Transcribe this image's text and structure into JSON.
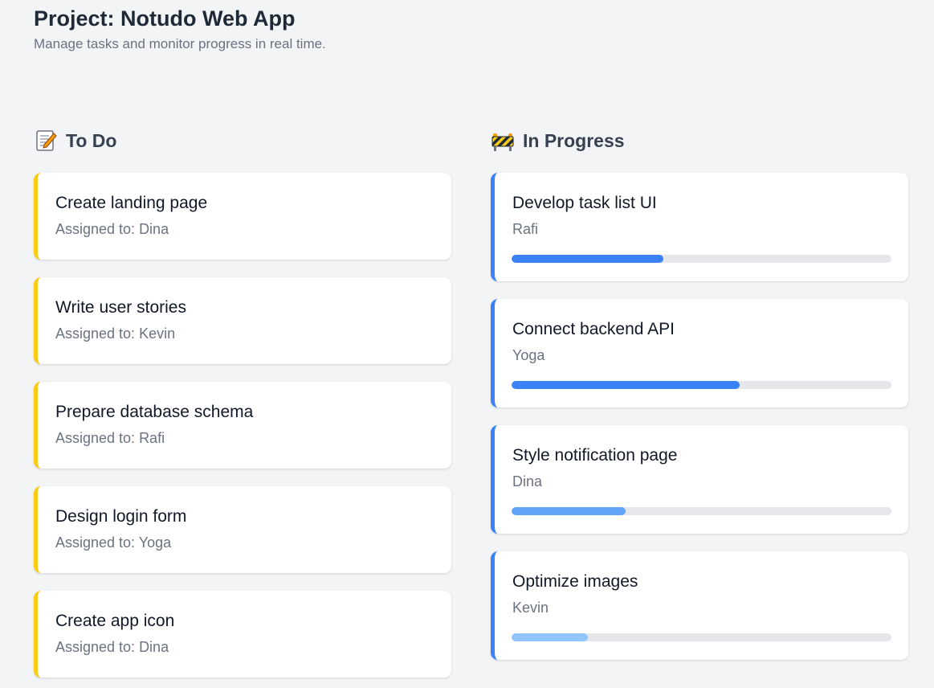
{
  "header": {
    "title": "Project: Notudo Web App",
    "subtitle": "Manage tasks and monitor progress in real time."
  },
  "columns": {
    "todo": {
      "title": "To Do",
      "icon": "memo-icon",
      "accent": "#facc15",
      "cards": [
        {
          "title": "Create landing page",
          "assignee": "Assigned to: Dina"
        },
        {
          "title": "Write user stories",
          "assignee": "Assigned to: Kevin"
        },
        {
          "title": "Prepare database schema",
          "assignee": "Assigned to: Rafi"
        },
        {
          "title": "Design login form",
          "assignee": "Assigned to: Yoga"
        },
        {
          "title": "Create app icon",
          "assignee": "Assigned to: Dina"
        }
      ]
    },
    "in_progress": {
      "title": "In Progress",
      "icon": "construction-barrier-icon",
      "accent": "#3b82f6",
      "cards": [
        {
          "title": "Develop task list UI",
          "assignee": "Rafi",
          "progress": 0.4,
          "bar_color": "#3b82f6"
        },
        {
          "title": "Connect backend API",
          "assignee": "Yoga",
          "progress": 0.6,
          "bar_color": "#3b82f6"
        },
        {
          "title": "Style notification page",
          "assignee": "Dina",
          "progress": 0.3,
          "bar_color": "#60a5fa"
        },
        {
          "title": "Optimize images",
          "assignee": "Kevin",
          "progress": 0.2,
          "bar_color": "#93c5fd"
        }
      ]
    }
  }
}
